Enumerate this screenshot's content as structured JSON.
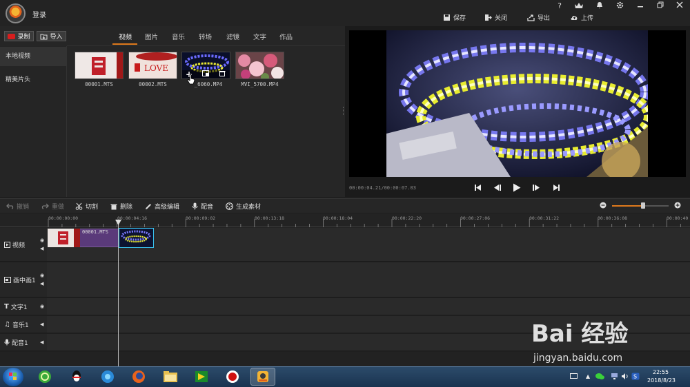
{
  "header": {
    "login": "登录"
  },
  "topbar": {
    "save": "保存",
    "close": "关闭",
    "export": "导出",
    "upload": "上传",
    "vip_label": "VIP",
    "help": "?"
  },
  "library": {
    "record": "录制",
    "import": "导入",
    "tabs": [
      "视频",
      "图片",
      "音乐",
      "转场",
      "滤镜",
      "文字",
      "作品"
    ],
    "active_tab": "视频",
    "sidebar": [
      "本地视频",
      "精美片头"
    ],
    "files": [
      "00001.MTS",
      "00002.MTS",
      "MVI_6060.MP4",
      "MVI_5700.MP4"
    ],
    "hover_file_visible_label": "_6060.MP4"
  },
  "preview": {
    "timecode": "00:00:04.21/00:00:07.03"
  },
  "edit_toolbar": {
    "undo": "撤销",
    "redo": "重做",
    "cut": "切割",
    "delete": "删除",
    "advanced": "高级编辑",
    "dub": "配音",
    "generate": "生成素材"
  },
  "ruler": {
    "ticks": [
      "00:00:00:00",
      "00:00:04:16",
      "00:00:09:02",
      "00:00:13:18",
      "00:00:18:04",
      "00:00:22:20",
      "00:00:27:06",
      "00:00:31:22",
      "00:00:36:08",
      "00:00:40"
    ]
  },
  "tracks": {
    "video": "视频",
    "pip": "画中画1",
    "text": "文字1",
    "music": "音乐1",
    "dub": "配音1"
  },
  "clips": {
    "clip1_label": "00001.MTS"
  },
  "taskbar": {
    "time": "22:55",
    "date": "2018/8/23"
  },
  "watermark": {
    "logo": "Bai 经验",
    "url": "jingyan.baidu.com"
  },
  "colors": {
    "accent": "#e07a1c",
    "clip_purple": "#5a3a7a",
    "selection_cyan": "#3ac3f0"
  }
}
